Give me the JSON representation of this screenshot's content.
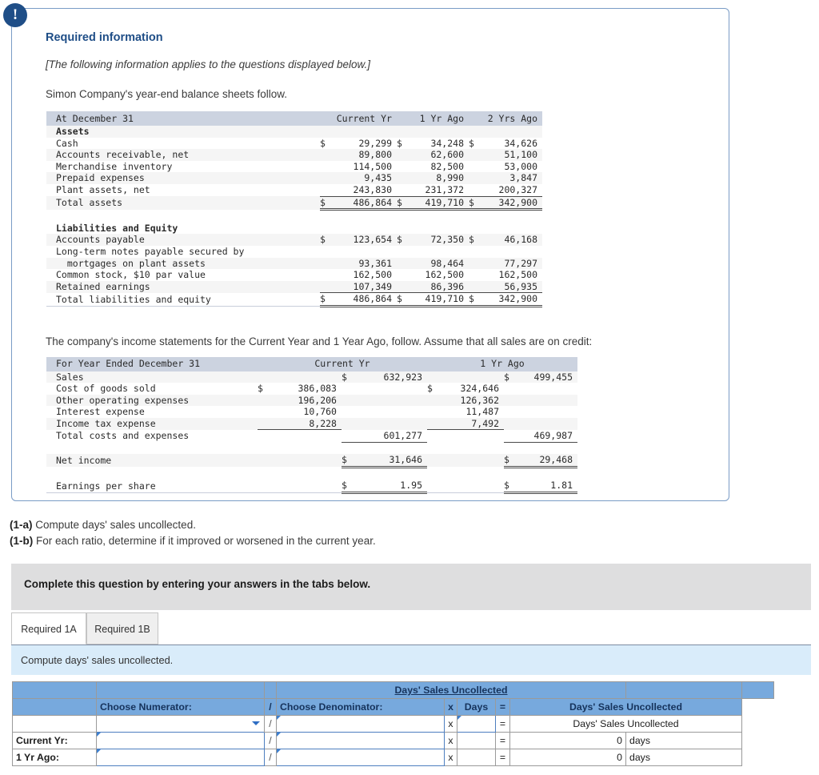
{
  "alert": {
    "icon": "exclamation-icon",
    "glyph": "!"
  },
  "required_info": {
    "title": "Required information",
    "note": "[The following information applies to the questions displayed below.]",
    "intro_balance": "Simon Company's year-end balance sheets follow.",
    "intro_income": "The company's income statements for the Current Year and 1 Year Ago, follow. Assume that all sales are on credit:"
  },
  "balance_sheet": {
    "header": [
      "At December 31",
      "Current Yr",
      "1 Yr Ago",
      "2 Yrs Ago"
    ],
    "sections": [
      {
        "label": "Assets",
        "bold": true
      },
      {
        "label": "Cash",
        "values": [
          "29,299",
          "34,248",
          "34,626"
        ],
        "dollar": true
      },
      {
        "label": "Accounts receivable, net",
        "values": [
          "89,800",
          "62,600",
          "51,100"
        ]
      },
      {
        "label": "Merchandise inventory",
        "values": [
          "114,500",
          "82,500",
          "53,000"
        ]
      },
      {
        "label": "Prepaid expenses",
        "values": [
          "9,435",
          "8,990",
          "3,847"
        ]
      },
      {
        "label": "Plant assets, net",
        "values": [
          "243,830",
          "231,372",
          "200,327"
        ],
        "underline": true
      },
      {
        "label": "Total assets",
        "values": [
          "486,864",
          "419,710",
          "342,900"
        ],
        "dollar": true,
        "double": true
      },
      {
        "label": "Liabilities and Equity",
        "bold": true
      },
      {
        "label": "Accounts payable",
        "values": [
          "123,654",
          "72,350",
          "46,168"
        ],
        "dollar": true
      },
      {
        "label": "Long-term notes payable secured by",
        "values": [
          "",
          "",
          ""
        ]
      },
      {
        "label": "  mortgages on plant assets",
        "values": [
          "93,361",
          "98,464",
          "77,297"
        ]
      },
      {
        "label": "Common stock, $10 par value",
        "values": [
          "162,500",
          "162,500",
          "162,500"
        ]
      },
      {
        "label": "Retained earnings",
        "values": [
          "107,349",
          "86,396",
          "56,935"
        ],
        "underline": true
      },
      {
        "label": "Total liabilities and equity",
        "values": [
          "486,864",
          "419,710",
          "342,900"
        ],
        "dollar": true,
        "double": true
      }
    ]
  },
  "income_statement": {
    "header": [
      "For Year Ended December 31",
      "Current Yr",
      "1 Yr Ago"
    ],
    "rows": [
      {
        "label": "Sales",
        "cy_sub": "",
        "cy_tot": "632,923",
        "cy_dollar_tot": true,
        "pa_sub": "",
        "pa_tot": "499,455",
        "pa_dollar_tot": true
      },
      {
        "label": "Cost of goods sold",
        "cy_sub": "386,083",
        "cy_dollar_sub": true,
        "cy_tot": "",
        "pa_sub": "324,646",
        "pa_dollar_sub": true,
        "pa_tot": ""
      },
      {
        "label": "Other operating expenses",
        "cy_sub": "196,206",
        "cy_tot": "",
        "pa_sub": "126,362",
        "pa_tot": ""
      },
      {
        "label": "Interest expense",
        "cy_sub": "10,760",
        "cy_tot": "",
        "pa_sub": "11,487",
        "pa_tot": ""
      },
      {
        "label": "Income tax expense",
        "cy_sub": "8,228",
        "cy_tot": "",
        "pa_sub": "7,492",
        "pa_tot": "",
        "underline_sub": true
      },
      {
        "label": "Total costs and expenses",
        "cy_sub": "",
        "cy_tot": "601,277",
        "pa_sub": "",
        "pa_tot": "469,987",
        "underline_tot": true
      },
      {
        "label": "Net income",
        "cy_sub": "",
        "cy_tot": "31,646",
        "cy_dollar_tot": true,
        "pa_sub": "",
        "pa_tot": "29,468",
        "pa_dollar_tot": true,
        "double_tot": true
      },
      {
        "label": "Earnings per share",
        "cy_sub": "",
        "cy_tot": "1.95",
        "cy_dollar_tot": true,
        "pa_sub": "",
        "pa_tot": "1.81",
        "pa_dollar_tot": true,
        "double_tot": true
      }
    ]
  },
  "questions": [
    {
      "num": "(1-a)",
      "text": " Compute days' sales uncollected."
    },
    {
      "num": "(1-b)",
      "text": " For each ratio, determine if it improved or worsened in the current year."
    }
  ],
  "instruction_bar": {
    "text": "Complete this question by entering your answers in the tabs below."
  },
  "tabs": [
    {
      "label": "Required 1A",
      "active": true
    },
    {
      "label": "Required 1B",
      "active": false
    }
  ],
  "tab_subtitle": "Compute days' sales uncollected.",
  "answer_table": {
    "title": "Days' Sales Uncollected",
    "columns": {
      "blank": "",
      "numerator": "Choose Numerator:",
      "slash": "/",
      "denominator": "Choose Denominator:",
      "times": "x",
      "days": "Days",
      "equals": "=",
      "result": "Days' Sales Uncollected"
    },
    "rows": [
      {
        "label": "",
        "numerator_value": "",
        "numerator_placeholder": "",
        "slash": "/",
        "denominator_value": "",
        "times": "x",
        "days_value": "",
        "equals": "=",
        "result": "Days' Sales Uncollected",
        "unit": "",
        "is_select_row": true
      },
      {
        "label": "Current Yr:",
        "numerator_value": "",
        "slash": "/",
        "denominator_value": "",
        "times": "x",
        "days_value": "",
        "equals": "=",
        "result": "0",
        "unit": "days",
        "is_select_row": false
      },
      {
        "label": "1 Yr Ago:",
        "numerator_value": "",
        "slash": "/",
        "denominator_value": "",
        "times": "x",
        "days_value": "",
        "equals": "=",
        "result": "0",
        "unit": "days",
        "is_select_row": false
      }
    ]
  },
  "colors": {
    "panel_border": "#7a9cc6",
    "badge": "#1f4e87",
    "heading": "#1f4e87",
    "table_header_bg": "#ccd3e0",
    "gray_bar": "#dededf",
    "blue_bar": "#d9ecfa",
    "grid_header": "#77a9dd"
  }
}
